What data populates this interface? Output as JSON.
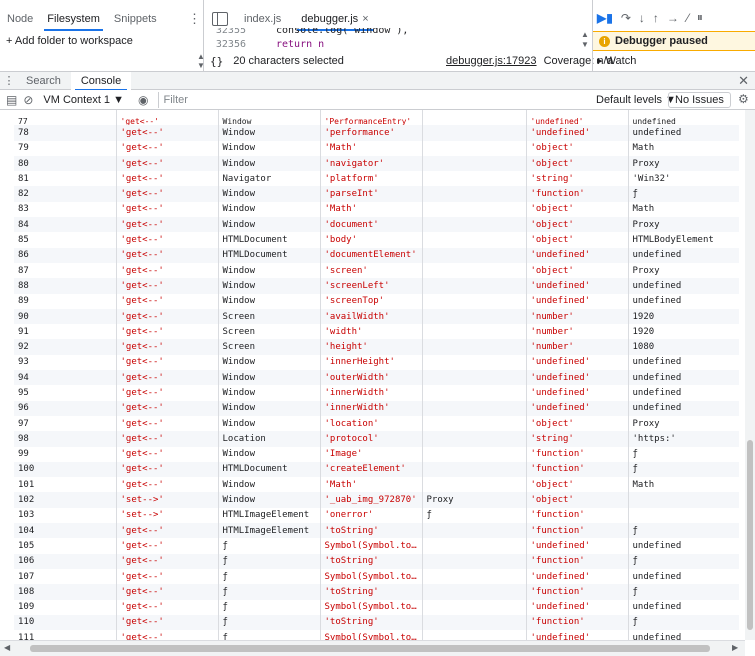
{
  "navigator": {
    "tabs": [
      "Node",
      "Filesystem",
      "Snippets"
    ],
    "active_tab": "Filesystem",
    "add_folder": "+ Add folder to workspace"
  },
  "editor": {
    "tabs": [
      {
        "label": "index.js",
        "closable": false
      },
      {
        "label": "debugger.js",
        "closable": true
      }
    ],
    "code": [
      {
        "line": "32355",
        "text": "console.log( window ),"
      },
      {
        "line": "32356",
        "text": "return n"
      }
    ],
    "selection_status": "20 characters selected",
    "file_location": "debugger.js:17923",
    "coverage": "Coverage: n/a"
  },
  "debugger": {
    "paused_text": "Debugger paused",
    "watch_label": "Watch"
  },
  "drawer": {
    "tabs": [
      "Search",
      "Console"
    ],
    "active_tab": "Console"
  },
  "console_toolbar": {
    "context": "VM Context 1 ▼",
    "filter_placeholder": "Filter",
    "levels": "Default levels ▼",
    "issues": "No Issues"
  },
  "partial_row": {
    "index": "77",
    "op": "'get<--'",
    "obj": "Window",
    "key": "'PerformanceEntry'",
    "val": "",
    "type": "'undefined'",
    "res": "undefined",
    "res_kind": "undef"
  },
  "rows": [
    {
      "index": "78",
      "op": "'get<--'",
      "obj": "Window",
      "key": "'performance'",
      "val": "",
      "type": "'undefined'",
      "res": "undefined",
      "res_kind": "undef"
    },
    {
      "index": "79",
      "op": "'get<--'",
      "obj": "Window",
      "key": "'Math'",
      "val": "",
      "type": "'object'",
      "res": "Math",
      "res_kind": "plain"
    },
    {
      "index": "80",
      "op": "'get<--'",
      "obj": "Window",
      "key": "'navigator'",
      "val": "",
      "type": "'object'",
      "res": "Proxy",
      "res_kind": "plain"
    },
    {
      "index": "81",
      "op": "'get<--'",
      "obj": "Navigator",
      "key": "'platform'",
      "val": "",
      "type": "'string'",
      "res": "'Win32'",
      "res_kind": "str"
    },
    {
      "index": "82",
      "op": "'get<--'",
      "obj": "Window",
      "key": "'parseInt'",
      "val": "",
      "type": "'function'",
      "res": "ƒ",
      "res_kind": "plain"
    },
    {
      "index": "83",
      "op": "'get<--'",
      "obj": "Window",
      "key": "'Math'",
      "val": "",
      "type": "'object'",
      "res": "Math",
      "res_kind": "plain"
    },
    {
      "index": "84",
      "op": "'get<--'",
      "obj": "Window",
      "key": "'document'",
      "val": "",
      "type": "'object'",
      "res": "Proxy",
      "res_kind": "plain"
    },
    {
      "index": "85",
      "op": "'get<--'",
      "obj": "HTMLDocument",
      "key": "'body'",
      "val": "",
      "type": "'object'",
      "res": "HTMLBodyElement",
      "res_kind": "plain"
    },
    {
      "index": "86",
      "op": "'get<--'",
      "obj": "HTMLDocument",
      "key": "'documentElement'",
      "val": "",
      "type": "'undefined'",
      "res": "undefined",
      "res_kind": "undef"
    },
    {
      "index": "87",
      "op": "'get<--'",
      "obj": "Window",
      "key": "'screen'",
      "val": "",
      "type": "'object'",
      "res": "Proxy",
      "res_kind": "plain"
    },
    {
      "index": "88",
      "op": "'get<--'",
      "obj": "Window",
      "key": "'screenLeft'",
      "val": "",
      "type": "'undefined'",
      "res": "undefined",
      "res_kind": "undef"
    },
    {
      "index": "89",
      "op": "'get<--'",
      "obj": "Window",
      "key": "'screenTop'",
      "val": "",
      "type": "'undefined'",
      "res": "undefined",
      "res_kind": "undef"
    },
    {
      "index": "90",
      "op": "'get<--'",
      "obj": "Screen",
      "key": "'availWidth'",
      "val": "",
      "type": "'number'",
      "res": "1920",
      "res_kind": "num"
    },
    {
      "index": "91",
      "op": "'get<--'",
      "obj": "Screen",
      "key": "'width'",
      "val": "",
      "type": "'number'",
      "res": "1920",
      "res_kind": "num"
    },
    {
      "index": "92",
      "op": "'get<--'",
      "obj": "Screen",
      "key": "'height'",
      "val": "",
      "type": "'number'",
      "res": "1080",
      "res_kind": "num"
    },
    {
      "index": "93",
      "op": "'get<--'",
      "obj": "Window",
      "key": "'innerHeight'",
      "val": "",
      "type": "'undefined'",
      "res": "undefined",
      "res_kind": "undef"
    },
    {
      "index": "94",
      "op": "'get<--'",
      "obj": "Window",
      "key": "'outerWidth'",
      "val": "",
      "type": "'undefined'",
      "res": "undefined",
      "res_kind": "undef"
    },
    {
      "index": "95",
      "op": "'get<--'",
      "obj": "Window",
      "key": "'innerWidth'",
      "val": "",
      "type": "'undefined'",
      "res": "undefined",
      "res_kind": "undef"
    },
    {
      "index": "96",
      "op": "'get<--'",
      "obj": "Window",
      "key": "'innerWidth'",
      "val": "",
      "type": "'undefined'",
      "res": "undefined",
      "res_kind": "undef"
    },
    {
      "index": "97",
      "op": "'get<--'",
      "obj": "Window",
      "key": "'location'",
      "val": "",
      "type": "'object'",
      "res": "Proxy",
      "res_kind": "plain"
    },
    {
      "index": "98",
      "op": "'get<--'",
      "obj": "Location",
      "key": "'protocol'",
      "val": "",
      "type": "'string'",
      "res": "'https:'",
      "res_kind": "str"
    },
    {
      "index": "99",
      "op": "'get<--'",
      "obj": "Window",
      "key": "'Image'",
      "val": "",
      "type": "'function'",
      "res": "ƒ",
      "res_kind": "plain"
    },
    {
      "index": "100",
      "op": "'get<--'",
      "obj": "HTMLDocument",
      "key": "'createElement'",
      "val": "",
      "type": "'function'",
      "res": "ƒ",
      "res_kind": "plain"
    },
    {
      "index": "101",
      "op": "'get<--'",
      "obj": "Window",
      "key": "'Math'",
      "val": "",
      "type": "'object'",
      "res": "Math",
      "res_kind": "plain"
    },
    {
      "index": "102",
      "op": "'set-->'",
      "obj": "Window",
      "key": "'_uab_img_972870'",
      "val": "Proxy",
      "type": "'object'",
      "res": "",
      "res_kind": "plain"
    },
    {
      "index": "103",
      "op": "'set-->'",
      "obj": "HTMLImageElement",
      "key": "'onerror'",
      "val": "ƒ",
      "type": "'function'",
      "res": "",
      "res_kind": "plain"
    },
    {
      "index": "104",
      "op": "'get<--'",
      "obj": "HTMLImageElement",
      "key": "'toString'",
      "val": "",
      "type": "'function'",
      "res": "ƒ",
      "res_kind": "plain"
    },
    {
      "index": "105",
      "op": "'get<--'",
      "obj": "ƒ",
      "key": "Symbol(Symbol.toPrimitive)",
      "val": "",
      "type": "'undefined'",
      "res": "undefined",
      "res_kind": "undef"
    },
    {
      "index": "106",
      "op": "'get<--'",
      "obj": "ƒ",
      "key": "'toString'",
      "val": "",
      "type": "'function'",
      "res": "ƒ",
      "res_kind": "plain"
    },
    {
      "index": "107",
      "op": "'get<--'",
      "obj": "ƒ",
      "key": "Symbol(Symbol.toPrimitive)",
      "val": "",
      "type": "'undefined'",
      "res": "undefined",
      "res_kind": "undef"
    },
    {
      "index": "108",
      "op": "'get<--'",
      "obj": "ƒ",
      "key": "'toString'",
      "val": "",
      "type": "'function'",
      "res": "ƒ",
      "res_kind": "plain"
    },
    {
      "index": "109",
      "op": "'get<--'",
      "obj": "ƒ",
      "key": "Symbol(Symbol.toPrimitive)",
      "val": "",
      "type": "'undefined'",
      "res": "undefined",
      "res_kind": "undef"
    },
    {
      "index": "110",
      "op": "'get<--'",
      "obj": "ƒ",
      "key": "'toString'",
      "val": "",
      "type": "'function'",
      "res": "ƒ",
      "res_kind": "plain"
    },
    {
      "index": "111",
      "op": "'get<--'",
      "obj": "ƒ",
      "key": "Symbol(Symbol.toPrimitive)",
      "val": "",
      "type": "'undefined'",
      "res": "undefined",
      "res_kind": "undef"
    }
  ],
  "colors": {
    "accent": "#1a73e8",
    "string": "#c80000",
    "number": "#1a1aa6",
    "undefined": "#80868b",
    "paused_banner": "#fef7e0"
  },
  "icons": [
    "kebab-icon",
    "panel-toggle-icon",
    "close-icon",
    "resume-icon",
    "step-over-icon",
    "step-into-icon",
    "step-out-icon",
    "step-icon",
    "deactivate-breakpoints-icon",
    "pause-exceptions-icon",
    "info-icon",
    "sidebar-icon",
    "clear-icon",
    "eye-icon",
    "gear-icon",
    "braces-icon"
  ]
}
